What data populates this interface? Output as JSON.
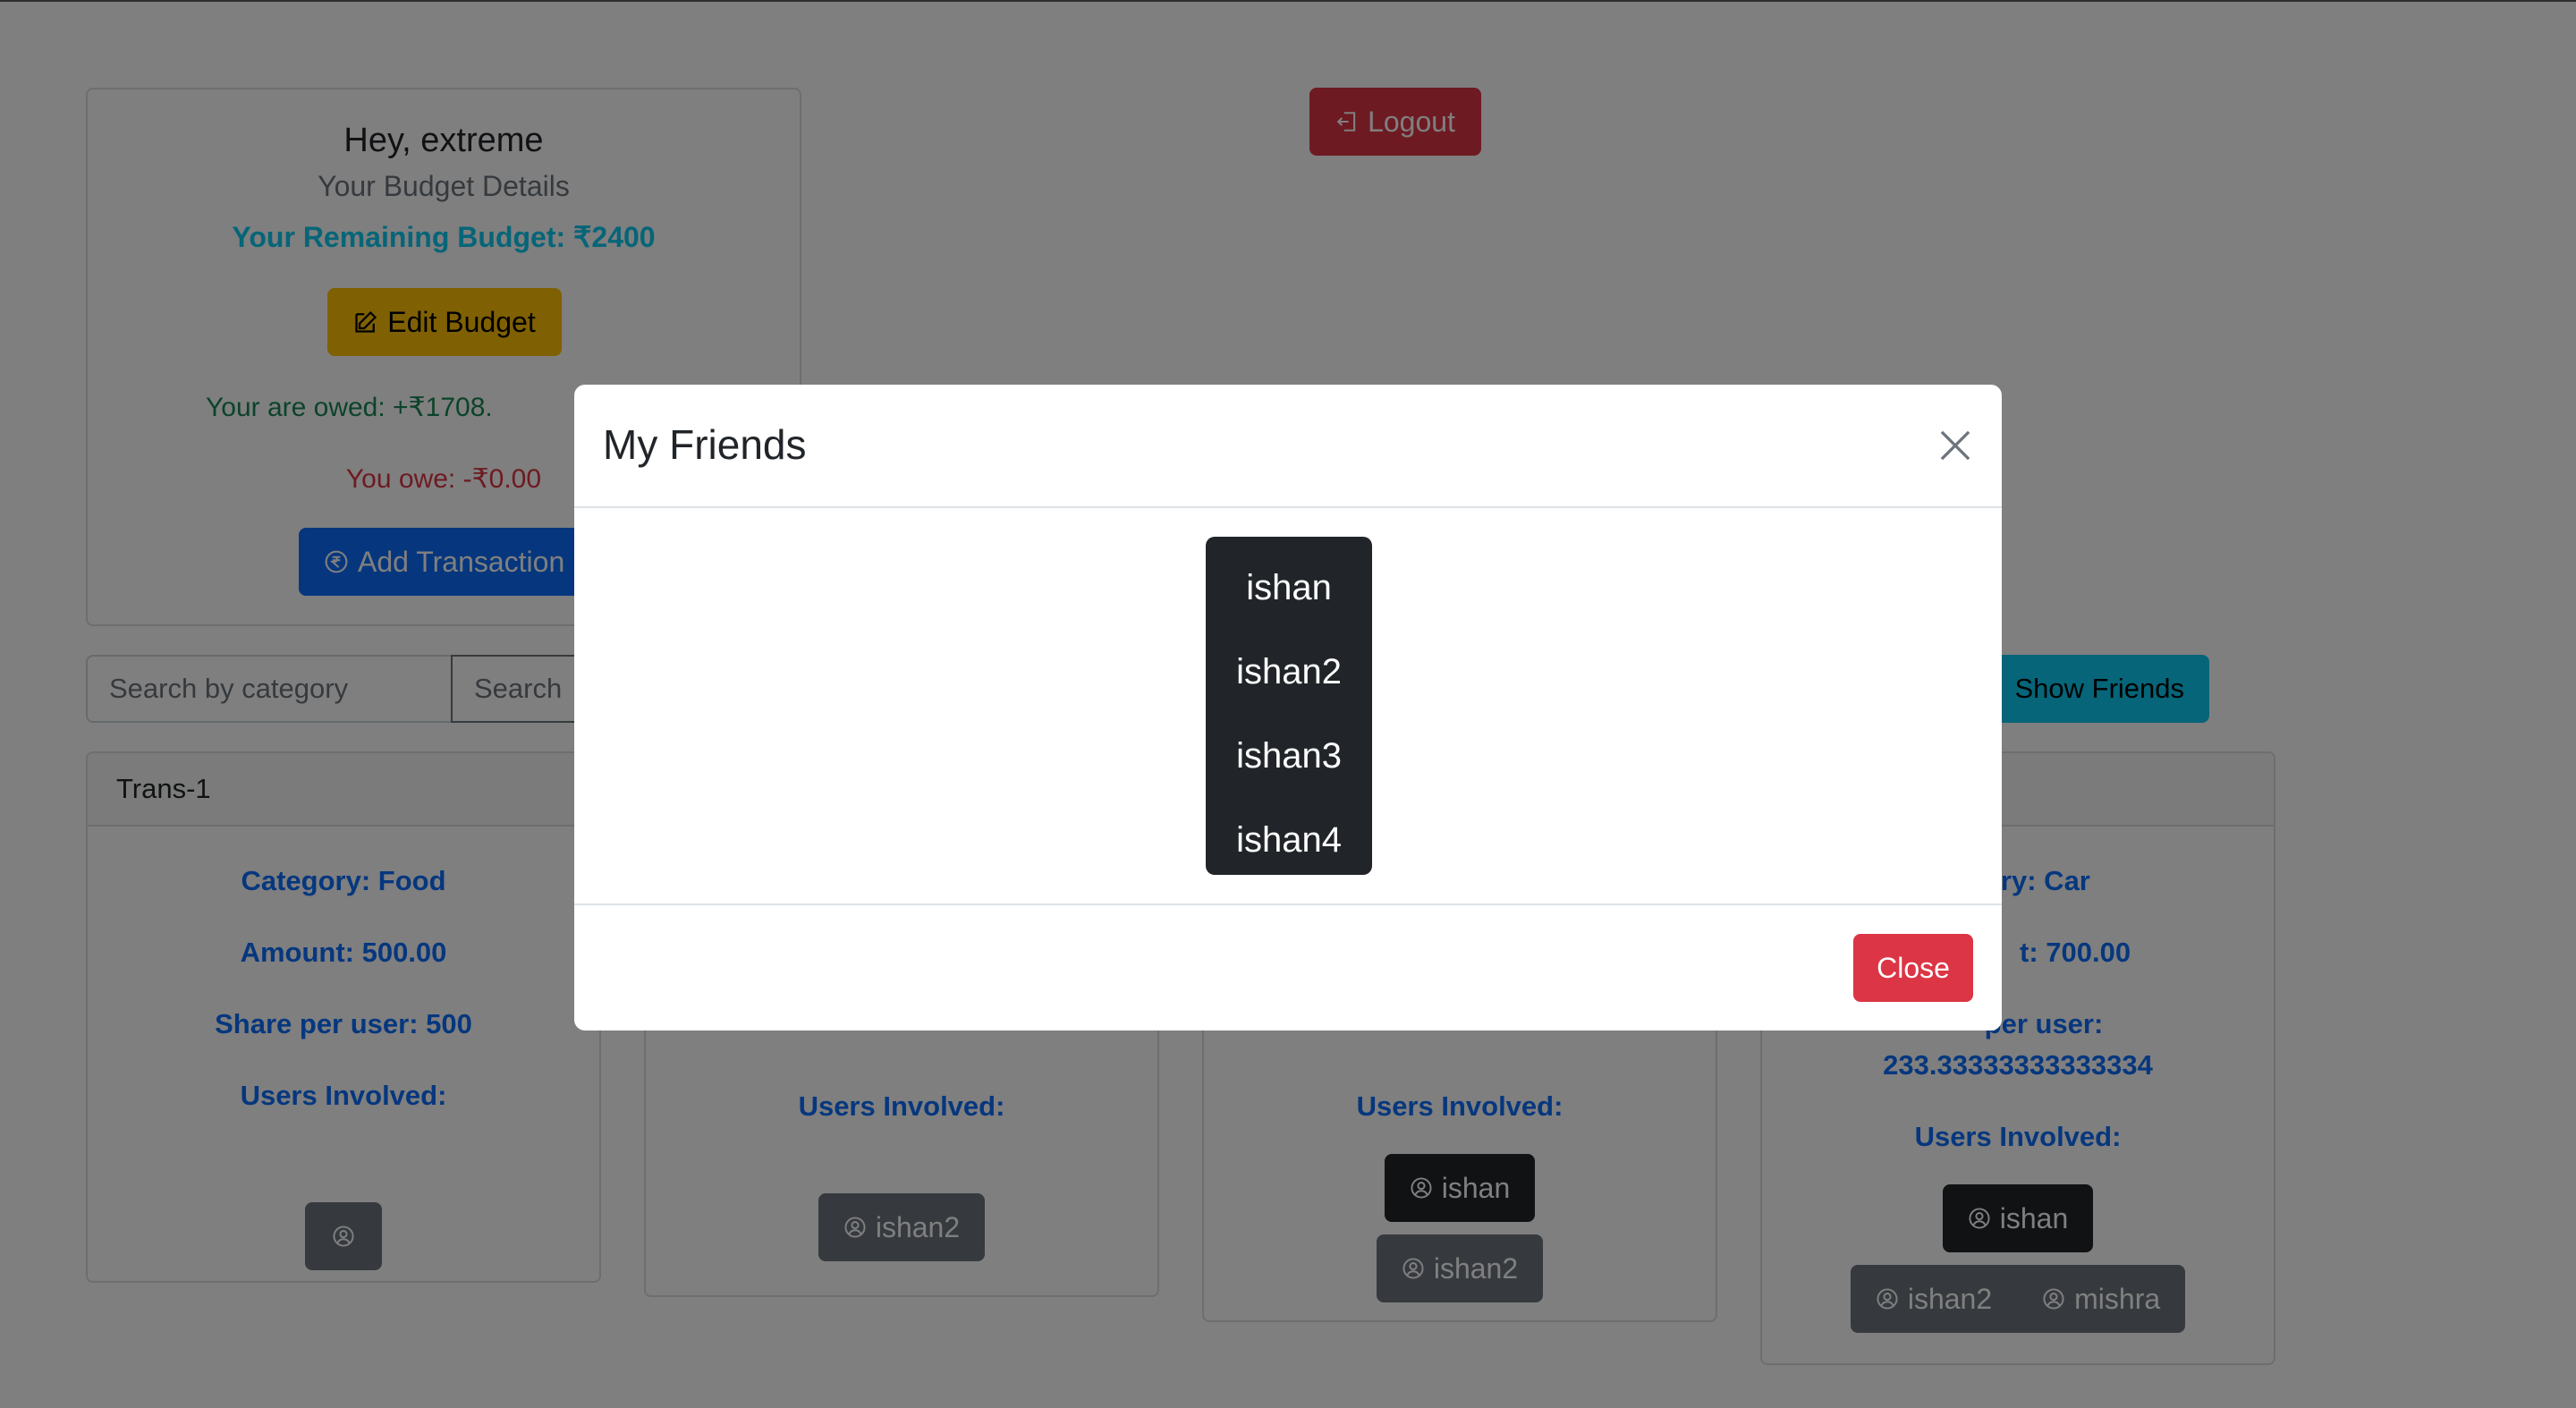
{
  "budget": {
    "greeting": "Hey, extreme",
    "subtitle": "Your Budget Details",
    "remaining": "Your Remaining Budget: ₹2400",
    "edit_label": "Edit Budget",
    "owed": "Your are owed: +₹1708.",
    "owe": "You owe: -₹0.00",
    "add_label": "Add Transaction"
  },
  "header": {
    "logout_label": "Logout"
  },
  "search": {
    "placeholder": "Search by category",
    "button_label": "Search"
  },
  "friends_button_label": "Show Friends",
  "transactions": [
    {
      "title": "Trans-1",
      "category": "Category: Food",
      "amount": "Amount: 500.00",
      "share": "Share per user: 500",
      "users_label": "Users Involved:"
    },
    {
      "users_label": "Users Involved:",
      "users": [
        "ishan2"
      ]
    },
    {
      "users_label": "Users Involved:",
      "users": [
        "ishan",
        "ishan2"
      ]
    },
    {
      "category": "ory: Car",
      "amount": "t: 700.00",
      "share_a": "per user:",
      "share_b": "233.33333333333334",
      "users_label": "Users Involved:",
      "users": [
        "ishan",
        "ishan2",
        "mishra"
      ]
    }
  ],
  "modal": {
    "title": "My Friends",
    "friends": [
      "ishan",
      "ishan2",
      "ishan3",
      "ishan4"
    ],
    "close_label": "Close"
  },
  "colors": {
    "primary": "#0d6efd",
    "danger": "#dc3545",
    "warning": "#ffc107",
    "info": "#0dcaf0",
    "success": "#198754",
    "dark": "#212529",
    "secondary": "#6c757d"
  }
}
